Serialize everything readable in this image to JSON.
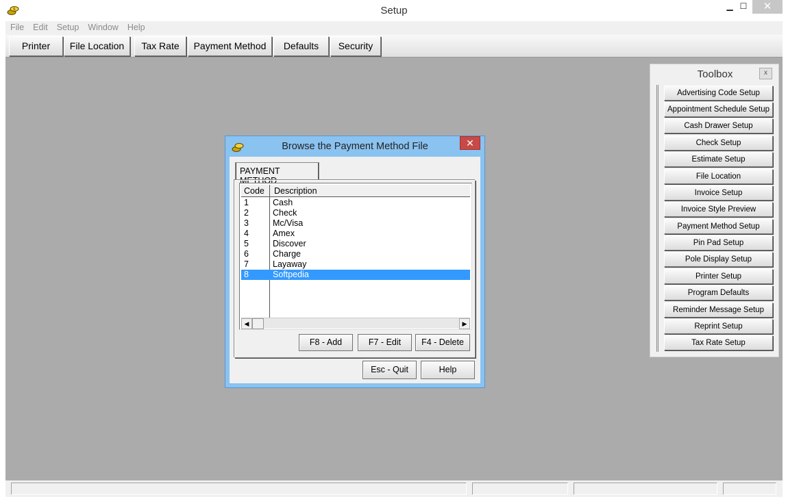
{
  "window": {
    "title": "Setup",
    "minimize": "▁",
    "maximize": "☐",
    "close": "✕"
  },
  "menu": [
    "File",
    "Edit",
    "Setup",
    "Window",
    "Help"
  ],
  "tabs": [
    "Printer",
    "File Location",
    "Tax Rate",
    "Payment Method",
    "Defaults",
    "Security"
  ],
  "dialog": {
    "title": "Browse the Payment Method File",
    "close": "✕",
    "tab_label": "PAYMENT METHOD",
    "columns": [
      "Code",
      "Description"
    ],
    "rows": [
      {
        "code": "1",
        "desc": "Cash"
      },
      {
        "code": "2",
        "desc": "Check"
      },
      {
        "code": "3",
        "desc": "Mc/Visa"
      },
      {
        "code": "4",
        "desc": "Amex"
      },
      {
        "code": "5",
        "desc": "Discover"
      },
      {
        "code": "6",
        "desc": "Charge"
      },
      {
        "code": "7",
        "desc": "Layaway"
      },
      {
        "code": "8",
        "desc": "Softpedia"
      }
    ],
    "selected_row": "8",
    "buttons": {
      "add": "F8 - Add",
      "edit": "F7 - Edit",
      "delete": "F4 - Delete",
      "quit": "Esc - Quit",
      "help": "Help"
    },
    "scroll_left": "◀",
    "scroll_right": "▶"
  },
  "toolbox": {
    "title": "Toolbox",
    "close": "x",
    "items": [
      "Advertising Code Setup",
      "Appointment Schedule Setup",
      "Cash Drawer Setup",
      "Check Setup",
      "Estimate Setup",
      "File Location",
      "Invoice Setup",
      "Invoice Style Preview",
      "Payment Method Setup",
      "Pin Pad Setup",
      "Pole Display Setup",
      "Printer Setup",
      "Program Defaults",
      "Reminder Message Setup",
      "Reprint Setup",
      "Tax Rate Setup"
    ]
  },
  "colors": {
    "workspace": "#ababab",
    "dialog_frame": "#8ac2f0",
    "selection": "#3399ff",
    "close_red": "#c74a46"
  }
}
